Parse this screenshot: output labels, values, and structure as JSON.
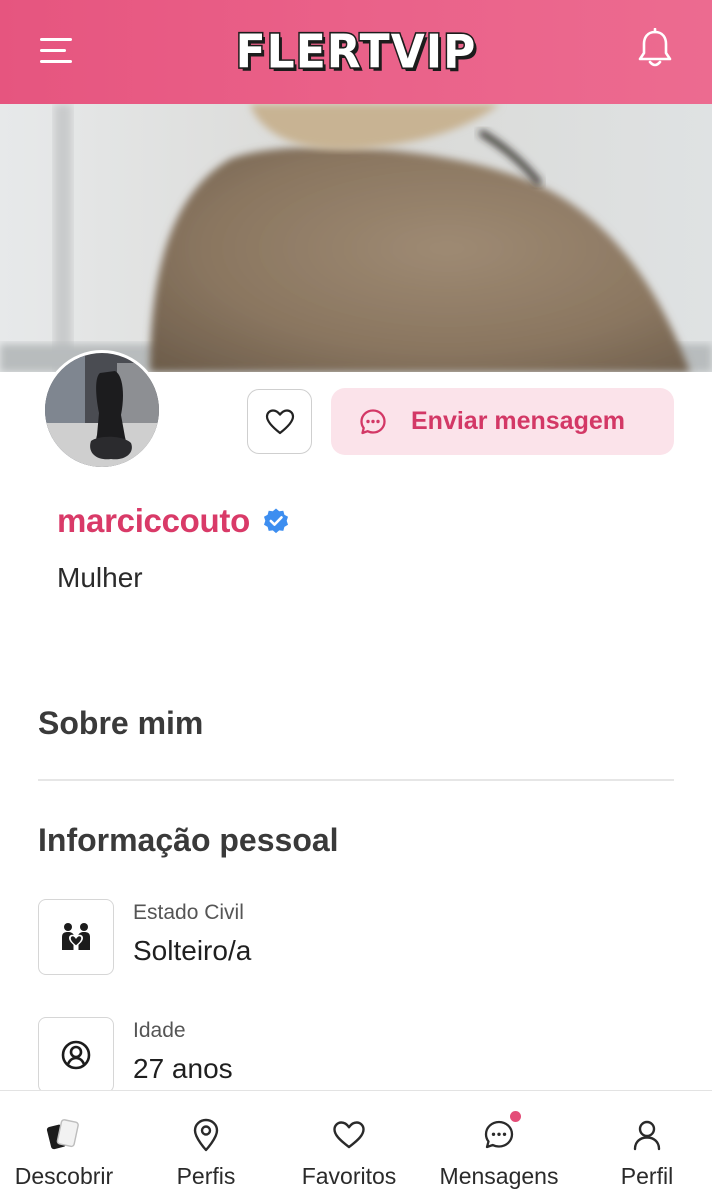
{
  "header": {
    "logo_text": "FLERTVIP",
    "brand_color": "#e85a84",
    "menu_icon": "hamburger-menu-icon",
    "notification_icon": "bell-icon"
  },
  "profile": {
    "username": "marciccouto",
    "verified": true,
    "gender": "Mulher",
    "favorite_icon": "heart-outline-icon",
    "message_button_label": "Enviar mensagem",
    "message_icon": "chat-bubble-icon"
  },
  "sections": {
    "about_title": "Sobre mim",
    "personal_info_title": "Informação pessoal"
  },
  "personal_info": [
    {
      "label": "Estado Civil",
      "value": "Solteiro/a",
      "icon": "couple-icon"
    },
    {
      "label": "Idade",
      "value": "27 anos",
      "icon": "user-circle-icon"
    }
  ],
  "bottom_nav": [
    {
      "label": "Descobrir",
      "icon": "cards-icon"
    },
    {
      "label": "Perfis",
      "icon": "location-pin-icon"
    },
    {
      "label": "Favoritos",
      "icon": "heart-icon"
    },
    {
      "label": "Mensagens",
      "icon": "chat-icon",
      "has_notification": true
    },
    {
      "label": "Perfil",
      "icon": "user-icon"
    }
  ]
}
